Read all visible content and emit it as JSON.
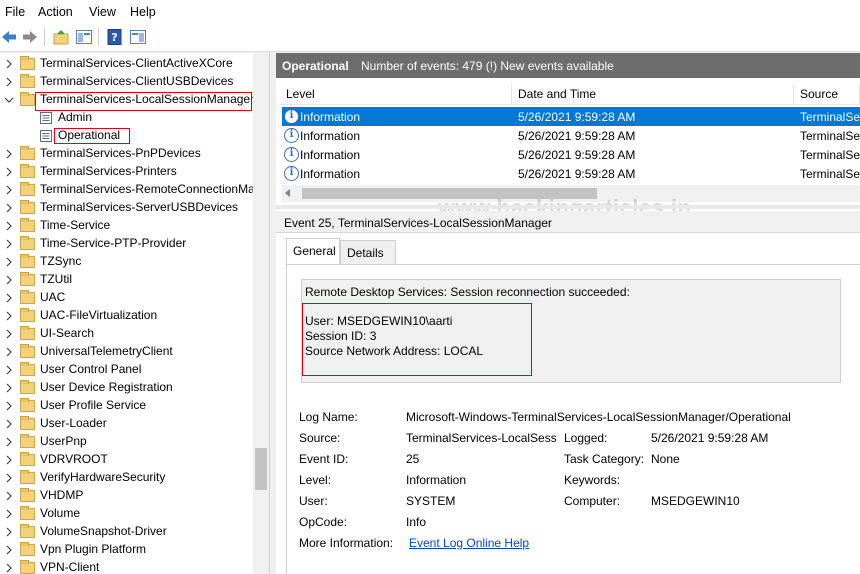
{
  "menu": [
    "File",
    "Action",
    "View",
    "Help"
  ],
  "tree": {
    "items": [
      {
        "label": "TerminalServices-ClientActiveXCore",
        "type": "folder",
        "expand": "collapsed"
      },
      {
        "label": "TerminalServices-ClientUSBDevices",
        "type": "folder",
        "expand": "collapsed"
      },
      {
        "label": "TerminalServices-LocalSessionManager",
        "type": "folder",
        "expand": "expanded"
      },
      {
        "label": "Admin",
        "type": "log",
        "expand": "none"
      },
      {
        "label": "Operational",
        "type": "log",
        "expand": "none"
      },
      {
        "label": "TerminalServices-PnPDevices",
        "type": "folder",
        "expand": "collapsed"
      },
      {
        "label": "TerminalServices-Printers",
        "type": "folder",
        "expand": "collapsed"
      },
      {
        "label": "TerminalServices-RemoteConnectionMa",
        "type": "folder",
        "expand": "collapsed"
      },
      {
        "label": "TerminalServices-ServerUSBDevices",
        "type": "folder",
        "expand": "collapsed"
      },
      {
        "label": "Time-Service",
        "type": "folder",
        "expand": "collapsed"
      },
      {
        "label": "Time-Service-PTP-Provider",
        "type": "folder",
        "expand": "collapsed"
      },
      {
        "label": "TZSync",
        "type": "folder",
        "expand": "collapsed"
      },
      {
        "label": "TZUtil",
        "type": "folder",
        "expand": "collapsed"
      },
      {
        "label": "UAC",
        "type": "folder",
        "expand": "collapsed"
      },
      {
        "label": "UAC-FileVirtualization",
        "type": "folder",
        "expand": "collapsed"
      },
      {
        "label": "UI-Search",
        "type": "folder",
        "expand": "collapsed"
      },
      {
        "label": "UniversalTelemetryClient",
        "type": "folder",
        "expand": "collapsed"
      },
      {
        "label": "User Control Panel",
        "type": "folder",
        "expand": "collapsed"
      },
      {
        "label": "User Device Registration",
        "type": "folder",
        "expand": "collapsed"
      },
      {
        "label": "User Profile Service",
        "type": "folder",
        "expand": "collapsed"
      },
      {
        "label": "User-Loader",
        "type": "folder",
        "expand": "collapsed"
      },
      {
        "label": "UserPnp",
        "type": "folder",
        "expand": "collapsed"
      },
      {
        "label": "VDRVROOT",
        "type": "folder",
        "expand": "collapsed"
      },
      {
        "label": "VerifyHardwareSecurity",
        "type": "folder",
        "expand": "collapsed"
      },
      {
        "label": "VHDMP",
        "type": "folder",
        "expand": "collapsed"
      },
      {
        "label": "Volume",
        "type": "folder",
        "expand": "collapsed"
      },
      {
        "label": "VolumeSnapshot-Driver",
        "type": "folder",
        "expand": "collapsed"
      },
      {
        "label": "Vpn Plugin Platform",
        "type": "folder",
        "expand": "collapsed"
      },
      {
        "label": "VPN-Client",
        "type": "folder",
        "expand": "collapsed"
      }
    ]
  },
  "header": {
    "title": "Operational",
    "subtitle": "Number of events: 479 (!) New events available"
  },
  "columns": [
    "Level",
    "Date and Time",
    "Source"
  ],
  "events": [
    {
      "level": "Information",
      "datetime": "5/26/2021 9:59:28 AM",
      "source": "TerminalServices-LocalSessionManager",
      "selected": true
    },
    {
      "level": "Information",
      "datetime": "5/26/2021 9:59:28 AM",
      "source": "TerminalServices-LocalSessionManager",
      "selected": false
    },
    {
      "level": "Information",
      "datetime": "5/26/2021 9:59:28 AM",
      "source": "TerminalServices-LocalSessionManager",
      "selected": false
    },
    {
      "level": "Information",
      "datetime": "5/26/2021 9:59:28 AM",
      "source": "TerminalServices-LocalSessionManager",
      "selected": false
    }
  ],
  "watermark": "www.hackingarticles.in",
  "detail": {
    "title": "Event 25, TerminalServices-LocalSessionManager",
    "tabs": [
      "General",
      "Details"
    ],
    "message": {
      "line1": "Remote Desktop Services: Session reconnection succeeded:",
      "user": "User: MSEDGEWIN10\\aarti",
      "session": "Session ID: 3",
      "address": "Source Network Address: LOCAL"
    },
    "fields": {
      "log_name_label": "Log Name:",
      "log_name": "Microsoft-Windows-TerminalServices-LocalSessionManager/Operational",
      "source_label": "Source:",
      "source": "TerminalServices-LocalSessio",
      "logged_label": "Logged:",
      "logged": "5/26/2021 9:59:28 AM",
      "event_id_label": "Event ID:",
      "event_id": "25",
      "task_category_label": "Task Category:",
      "task_category": "None",
      "level_label": "Level:",
      "level": "Information",
      "keywords_label": "Keywords:",
      "keywords": "",
      "user_label": "User:",
      "user": "SYSTEM",
      "computer_label": "Computer:",
      "computer": "MSEDGEWIN10",
      "opcode_label": "OpCode:",
      "opcode": "Info",
      "more_info_label": "More Information:",
      "more_info_link": "Event Log Online Help"
    }
  },
  "colors": {
    "selection": "#0078d7",
    "header": "#6d6d6d",
    "highlight_box": "#d9001b",
    "link": "#0645c8"
  }
}
